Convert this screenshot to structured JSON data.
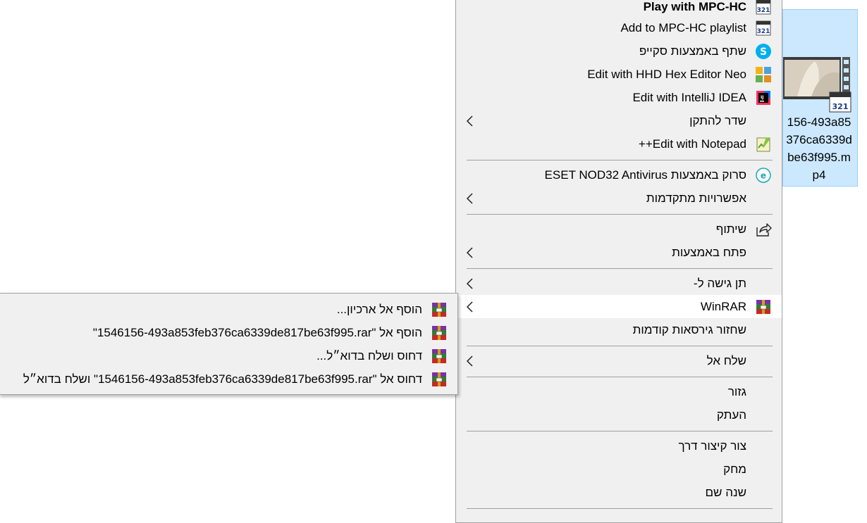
{
  "context_menu": {
    "items": [
      {
        "label": "Play with MPC-HC",
        "icon": "mpc-hc-icon",
        "bold": true,
        "submenu": false
      },
      {
        "label": "Add to MPC-HC playlist",
        "icon": "mpc-hc-icon",
        "submenu": false
      },
      {
        "label": "שתף באמצעות סקייפ",
        "icon": "skype-icon",
        "submenu": false
      },
      {
        "label": "Edit with HHD Hex Editor Neo",
        "icon": "hex-editor-icon",
        "submenu": false
      },
      {
        "label": "Edit with IntelliJ IDEA",
        "icon": "intellij-icon",
        "submenu": false
      },
      {
        "label": "שדר להתקן",
        "icon": "",
        "submenu": true
      },
      {
        "label": "Edit with Notepad++",
        "icon": "notepadpp-icon",
        "submenu": false
      },
      {
        "label": "סרוק באמצעות ESET NOD32 Antivirus",
        "icon": "eset-icon",
        "submenu": false
      },
      {
        "label": "אפשרויות מתקדמות",
        "icon": "",
        "submenu": true
      },
      {
        "label": "שיתוף",
        "icon": "share-icon",
        "submenu": false
      },
      {
        "label": "פתח באמצעות",
        "icon": "",
        "submenu": true
      },
      {
        "label": "תן גישה ל-",
        "icon": "",
        "submenu": true
      },
      {
        "label": "WinRAR",
        "icon": "winrar-icon",
        "submenu": true,
        "highlighted": true
      },
      {
        "label": "שחזור גירסאות קודמות",
        "icon": "",
        "submenu": false
      },
      {
        "label": "שלח אל",
        "icon": "",
        "submenu": true
      },
      {
        "label": "גזור",
        "icon": "",
        "submenu": false
      },
      {
        "label": "העתק",
        "icon": "",
        "submenu": false
      },
      {
        "label": "צור קיצור דרך",
        "icon": "",
        "submenu": false
      },
      {
        "label": "מחק",
        "icon": "",
        "submenu": false
      },
      {
        "label": "שנה שם",
        "icon": "",
        "submenu": false
      }
    ]
  },
  "winrar_submenu": {
    "items": [
      {
        "label": "הוסף אל ארכיון...",
        "icon": "winrar-icon"
      },
      {
        "label": "הוסף אל \"1546156-493a853feb376ca6339de817be63f995.rar\"",
        "icon": "winrar-icon"
      },
      {
        "label": "דחוס ושלח בדוא״ל...",
        "icon": "winrar-icon"
      },
      {
        "label": "דחוס אל \"1546156-493a853feb376ca6339de817be63f995.rar\" ושלח בדוא״ל",
        "icon": "winrar-icon"
      }
    ]
  },
  "selected_file": {
    "name_lines": [
      "156-493a85",
      "376ca6339d",
      "be63f995.m",
      "p4"
    ],
    "icon": "video-thumbnail-icon",
    "badge": "mpc-hc-icon"
  },
  "colors": {
    "menu_bg": "#f0f0f0",
    "menu_hover": "#ffffff",
    "selection_bg": "#cce8ff",
    "separator": "#a0a0a0"
  }
}
